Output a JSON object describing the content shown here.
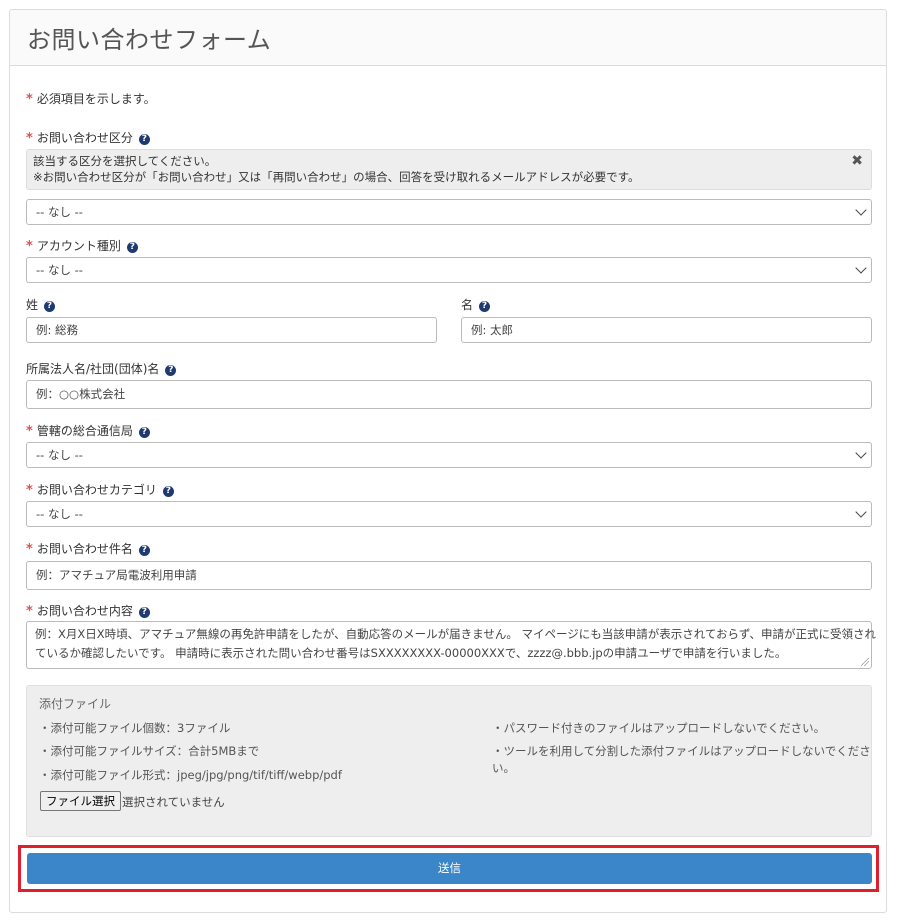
{
  "page": {
    "title": "お問い合わせフォーム",
    "required_note": "必須項目を示します。",
    "required_mark": "*"
  },
  "fields": {
    "inquiry_type": {
      "label": "お問い合わせ区分",
      "info_line1": "該当する区分を選択してください。",
      "info_line2": "※お問い合わせ区分が「お問い合わせ」又は「再問い合わせ」の場合、回答を受け取れるメールアドレスが必要です。",
      "value": "-- なし --"
    },
    "account_type": {
      "label": "アカウント種別",
      "value": "-- なし --"
    },
    "last_name": {
      "label": "姓",
      "placeholder": "例: 総務"
    },
    "first_name": {
      "label": "名",
      "placeholder": "例: 太郎"
    },
    "organization": {
      "label": "所属法人名/社団(団体)名",
      "placeholder": "例：○○株式会社"
    },
    "bureau": {
      "label": "管轄の総合通信局",
      "value": "-- なし --"
    },
    "category": {
      "label": "お問い合わせカテゴリ",
      "value": "-- なし --"
    },
    "subject": {
      "label": "お問い合わせ件名",
      "placeholder": "例：アマチュア局電波利用申請"
    },
    "content": {
      "label": "お問い合わせ内容",
      "placeholder_line1": "例：X月X日X時頃、アマチュア無線の再免許申請をしたが、自動応答のメールが届きません。 マイページにも当該申請が表示されておらず、申請が正式に受領され",
      "placeholder_line2": "ているか確認したいです。 申請時に表示された問い合わせ番号はSXXXXXXXX-00000XXXで、zzzz@.bbb.jpの申請ユーザで申請を行いました。"
    }
  },
  "attachment": {
    "title": "添付ファイル",
    "left_items": [
      "・添付可能ファイル個数：3ファイル",
      "・添付可能ファイルサイズ：合計5MBまで",
      "・添付可能ファイル形式：jpeg/jpg/png/tif/tiff/webp/pdf"
    ],
    "right_item1": "・パスワード付きのファイルはアップロードしないでください。",
    "right_item2_line1": "・ツールを利用して分割した添付ファイルはアップロードしないでくださ",
    "right_item2_line2": "い。",
    "choose_button": "ファイル選択",
    "no_file": "選択されていません"
  },
  "submit": {
    "label": "送信"
  },
  "icons": {
    "help": "question-circle-icon",
    "select": "chevron-down-icon",
    "close": "close-icon"
  },
  "colors": {
    "required": "#d9534f",
    "submit": "#3a86c8",
    "highlight": "#e01e2e",
    "help": "#1f3b6e"
  }
}
